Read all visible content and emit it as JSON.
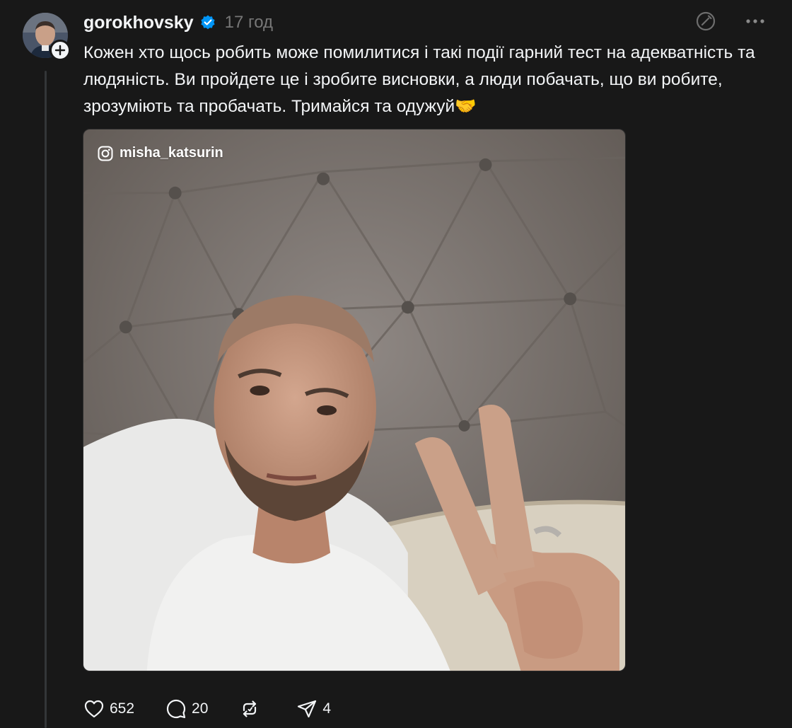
{
  "author": {
    "username": "gorokhovsky",
    "timestamp": "17 год",
    "verified": true,
    "avatar_icon": "user-avatar"
  },
  "post": {
    "text": "Кожен хто щось робить може помилитися і такі події гарний тест на адекватність та людяність. Ви пройдете це і зробите висновки, а люди побачать, що ви робите, зрозуміють та пробачать. Тримайся та одужуй🤝",
    "media": {
      "watermark": "misha_katsurin",
      "watermark_icon": "instagram-icon"
    }
  },
  "stats": {
    "likes": "652",
    "comments": "20",
    "reposts": "",
    "shares": "4"
  },
  "colors": {
    "background": "#181818",
    "text": "#f3f5f7",
    "muted": "#777777",
    "verified": "#0095f6",
    "thread_line": "#333638"
  }
}
